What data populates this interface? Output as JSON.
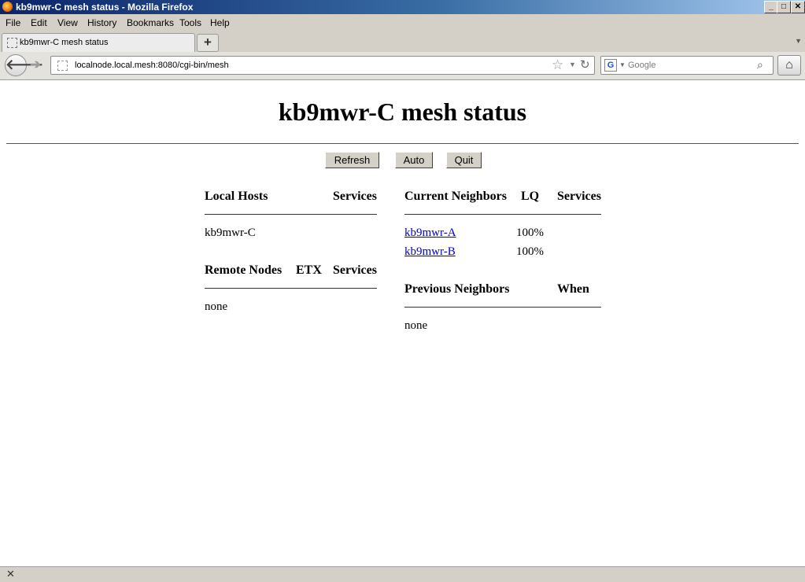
{
  "window": {
    "title": "kb9mwr-C mesh status - Mozilla Firefox",
    "controls": {
      "minimize": "_",
      "maximize": "□",
      "close": "✕"
    }
  },
  "menu": [
    "File",
    "Edit",
    "View",
    "History",
    "Bookmarks",
    "Tools",
    "Help"
  ],
  "tabs": [
    {
      "label": "kb9mwr-C mesh status"
    }
  ],
  "new_tab_label": "+",
  "navbar": {
    "url": "localnode.local.mesh:8080/cgi-bin/mesh",
    "search_placeholder": "Google",
    "search_engine_icon": "G"
  },
  "icons": {
    "back": "🡐",
    "forward": "➔",
    "star": "☆",
    "dropdown": "▼",
    "reload": "↻",
    "magnifier": "⌕",
    "home": "⌂",
    "close": "✕",
    "tab_list": "▼"
  },
  "page": {
    "title": "kb9mwr-C mesh status",
    "buttons": {
      "refresh": "Refresh",
      "auto": "Auto",
      "quit": "Quit"
    },
    "local_hosts": {
      "headers": [
        "Local Hosts",
        "Services"
      ],
      "rows": [
        {
          "host": "kb9mwr-C",
          "services": ""
        }
      ]
    },
    "remote_nodes": {
      "headers": [
        "Remote Nodes",
        "ETX",
        "Services"
      ],
      "empty": "none"
    },
    "current_neighbors": {
      "headers": [
        "Current Neighbors",
        "LQ",
        "Services"
      ],
      "rows": [
        {
          "name": "kb9mwr-A",
          "lq": "100%",
          "services": ""
        },
        {
          "name": "kb9mwr-B",
          "lq": "100%",
          "services": ""
        }
      ]
    },
    "previous_neighbors": {
      "headers": [
        "Previous Neighbors",
        "When"
      ],
      "empty": "none"
    }
  },
  "colors": {
    "link": "#0000cc",
    "chrome": "#d4d0c8",
    "titlebar": "#0a246a"
  }
}
